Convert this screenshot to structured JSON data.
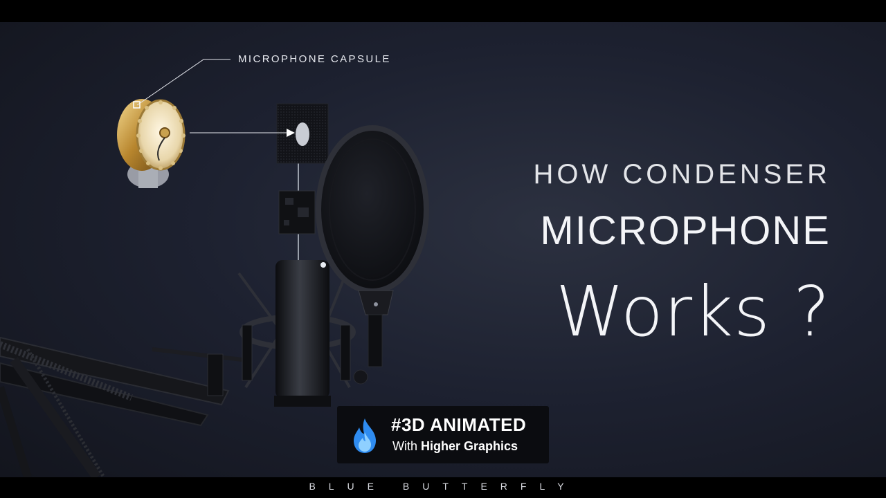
{
  "callout": {
    "label": "MICROPHONE CAPSULE"
  },
  "headline": {
    "line1": "HOW CONDENSER",
    "line2": "MICROPHONE",
    "line3": "Works ?"
  },
  "badge": {
    "title": "#3D ANIMATED",
    "subtitle_prefix": "With",
    "subtitle_bold": "Higher Graphics",
    "icon": "flame-icon"
  },
  "footer": {
    "brand": "BLUE BUTTERFLY"
  },
  "colors": {
    "background": "#1d2130",
    "text": "#f4f5f8",
    "badge_bg": "#0b0c10",
    "flame_blue": "#2f8cf0",
    "capsule_gold": "#c9a14e"
  }
}
